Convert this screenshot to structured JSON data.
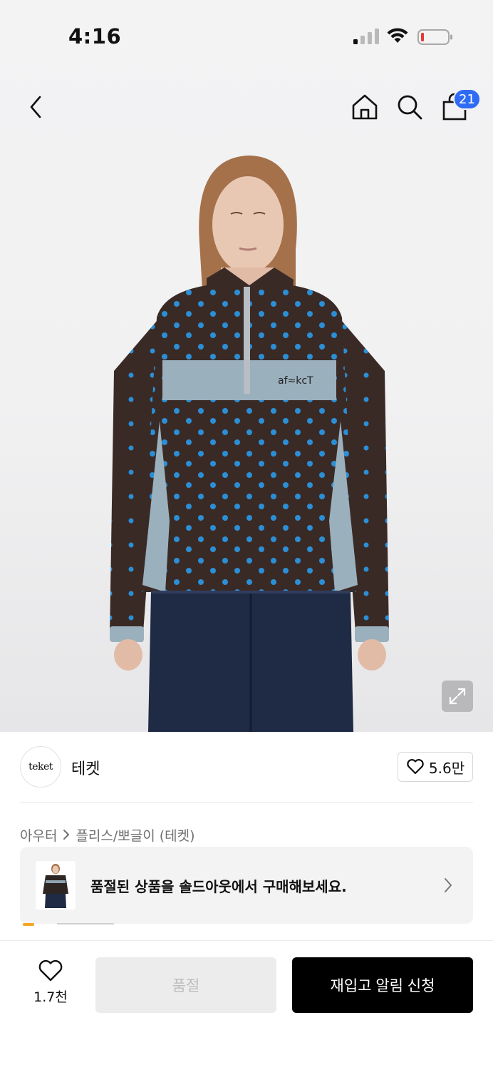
{
  "status_bar": {
    "time": "4:16",
    "icons": [
      "signal-icon",
      "wifi-icon",
      "battery-low-icon"
    ]
  },
  "header": {
    "back_icon": "chevron-left-icon",
    "home_icon": "home-icon",
    "search_icon": "search-icon",
    "cart_icon": "shopping-bag-icon",
    "cart_badge": "21"
  },
  "product_image": {
    "description_icon": "expand-icon"
  },
  "brand": {
    "logo_text": "teket",
    "name": "테켓",
    "like_count": "5.6만",
    "like_icon": "heart-outline-icon"
  },
  "breadcrumb": {
    "items": [
      "아우터",
      "플리스/뽀글이 (테켓)"
    ]
  },
  "soldout_banner": {
    "text": "품절된 상품을 솔드아웃에서 구매해보세요.",
    "chevron_icon": "chevron-right-icon"
  },
  "bottom_bar": {
    "like_count": "1.7천",
    "soldout_label": "품절",
    "restock_label": "재입고 알림 신청"
  },
  "colors": {
    "badge_blue": "#2f6bf5",
    "primary_black": "#000000",
    "disabled_gray": "#ececec",
    "banner_bg": "#f3f3f4",
    "fleece_brown": "#3a2a26",
    "fleece_blue_gray": "#9bb0bd",
    "dot_blue": "#2b8fd6"
  }
}
